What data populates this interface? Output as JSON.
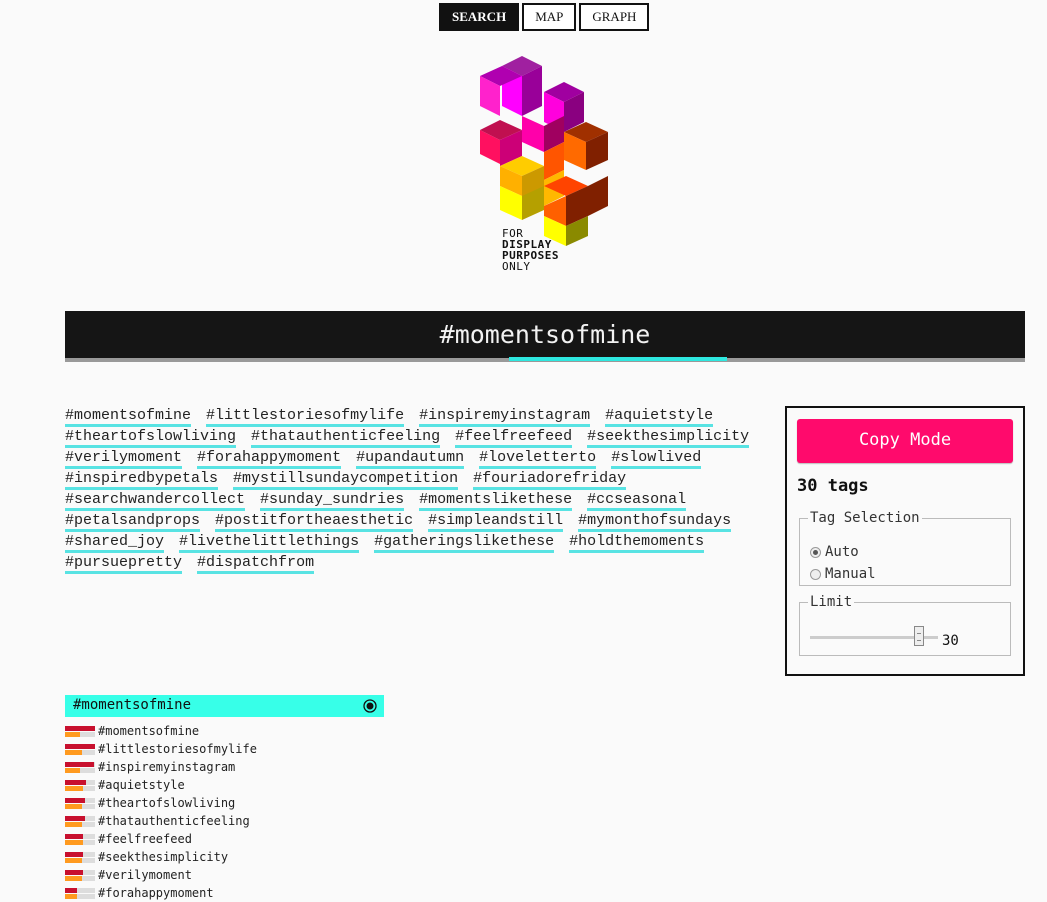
{
  "nav": [
    {
      "label": "SEARCH",
      "active": true
    },
    {
      "label": "MAP",
      "active": false
    },
    {
      "label": "GRAPH",
      "active": false
    }
  ],
  "logo": {
    "line1": "FOR",
    "line2": "DISPLAY",
    "line3": "PURPOSES",
    "line4": "ONLY"
  },
  "banner": {
    "title": "#momentsofmine"
  },
  "tags": [
    "#momentsofmine",
    "#littlestoriesofmylife",
    "#inspiremyinstagram",
    "#aquietstyle",
    "#theartofslowliving",
    "#thatauthenticfeeling",
    "#feelfreefeed",
    "#seekthesimplicity",
    "#verilymoment",
    "#forahappymoment",
    "#upandautumn",
    "#loveletterto",
    "#slowlived",
    "#inspiredbypetals",
    "#mystillsundaycompetition",
    "#fouriadorefriday",
    "#searchwandercollect",
    "#sunday_sundries",
    "#momentslikethese",
    "#ccseasonal",
    "#petalsandprops",
    "#postitfortheaesthetic",
    "#simpleandstill",
    "#mymonthofsundays",
    "#shared_joy",
    "#livethelittlethings",
    "#gatheringslikethese",
    "#holdthemoments",
    "#pursuepretty",
    "#dispatchfrom"
  ],
  "panel": {
    "copy_label": "Copy Mode",
    "count_label": "30 tags",
    "tag_selection_legend": "Tag Selection",
    "auto_label": "Auto",
    "manual_label": "Manual",
    "selected_mode": "Auto",
    "limit_legend": "Limit",
    "limit_value": "30",
    "limit_fraction": 0.85
  },
  "ranking": {
    "title": "#momentsofmine",
    "icon": "target-icon",
    "colors": {
      "primary": "#c8102e",
      "secondary": "#ff9a1f",
      "header": "#37ffe8"
    },
    "rows": [
      {
        "label": "#momentsofmine",
        "primary": 1.0,
        "secondary": 0.5
      },
      {
        "label": "#littlestoriesofmylife",
        "primary": 1.0,
        "secondary": 0.55
      },
      {
        "label": "#inspiremyinstagram",
        "primary": 0.95,
        "secondary": 0.5
      },
      {
        "label": "#aquietstyle",
        "primary": 0.7,
        "secondary": 0.6
      },
      {
        "label": "#theartofslowliving",
        "primary": 0.65,
        "secondary": 0.55
      },
      {
        "label": "#thatauthenticfeeling",
        "primary": 0.65,
        "secondary": 0.55
      },
      {
        "label": "#feelfreefeed",
        "primary": 0.6,
        "secondary": 0.6
      },
      {
        "label": "#seekthesimplicity",
        "primary": 0.6,
        "secondary": 0.55
      },
      {
        "label": "#verilymoment",
        "primary": 0.6,
        "secondary": 0.55
      },
      {
        "label": "#forahappymoment",
        "primary": 0.4,
        "secondary": 0.4
      }
    ]
  }
}
